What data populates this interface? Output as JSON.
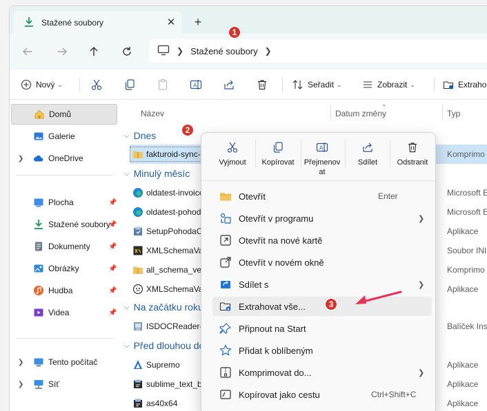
{
  "tab": {
    "title": "Stažené soubory",
    "close_icon": "close-icon",
    "new_tab_icon": "plus-icon"
  },
  "address": {
    "crumbs": [
      "Stažené soubory"
    ]
  },
  "toolbar": {
    "new_label": "Nový",
    "sort_label": "Seřadit",
    "view_label": "Zobrazit",
    "extract_label": "Extraho"
  },
  "sidebar": {
    "items": [
      {
        "label": "Domů"
      },
      {
        "label": "Galerie"
      },
      {
        "label": "OneDrive"
      },
      {
        "label": "Plocha"
      },
      {
        "label": "Stažené soubory"
      },
      {
        "label": "Dokumenty"
      },
      {
        "label": "Obrázky"
      },
      {
        "label": "Hudba"
      },
      {
        "label": "Videa"
      },
      {
        "label": "Tento počítač"
      },
      {
        "label": "Síť"
      }
    ]
  },
  "columns": {
    "name": "Název",
    "date": "Datum změny",
    "type": "Typ"
  },
  "groups": {
    "today": "Dnes",
    "last_month": "Minulý měsíc",
    "year_start": "Na začátku roku",
    "long_ago": "Před dlouhou do"
  },
  "files": [
    {
      "name": "fakturoid-sync-v1",
      "type": "Komprimo"
    },
    {
      "name": "oldatest-invoices_",
      "type": "Microsoft E"
    },
    {
      "name": "oldatest-pohoda-",
      "type": "Microsoft E"
    },
    {
      "name": "SetupPohodaCZ_",
      "type": "Aplikace"
    },
    {
      "name": "XMLSchemaValid",
      "type": "Soubor INI"
    },
    {
      "name": "all_schema_ver2",
      "type": "Komprimo"
    },
    {
      "name": "XMLSchemaValid",
      "type": "Aplikace"
    },
    {
      "name": "ISDOCReader-4.0.",
      "type": "Balíček Inst"
    },
    {
      "name": "Supremo",
      "type": "Aplikace"
    },
    {
      "name": "sublime_text_buil",
      "type": "Aplikace"
    },
    {
      "name": "as40x64",
      "type": "Aplikace"
    }
  ],
  "context_menu": {
    "actions": [
      {
        "label": "Vyjmout"
      },
      {
        "label": "Kopírovat"
      },
      {
        "label": "Přejmenov at"
      },
      {
        "label": "Sdílet"
      },
      {
        "label": "Odstranit"
      }
    ],
    "items": [
      {
        "label": "Otevřít",
        "shortcut": "Enter"
      },
      {
        "label": "Otevřít v programu"
      },
      {
        "label": "Otevřít na nové kartě"
      },
      {
        "label": "Otevřít v novém okně"
      },
      {
        "label": "Sdílet s"
      },
      {
        "label": "Extrahovat vše..."
      },
      {
        "label": "Připnout na Start"
      },
      {
        "label": "Přidat k oblíbeným"
      },
      {
        "label": "Komprimovat do..."
      },
      {
        "label": "Kopírovat jako cestu",
        "shortcut": "Ctrl+Shift+C"
      }
    ]
  },
  "annotations": {
    "badge1": "1",
    "badge2": "2",
    "badge3": "3"
  },
  "colors": {
    "accent": "#0067c0",
    "group_heading": "#1f5ea8",
    "selection": "#cce4f7",
    "badge": "#d9322b",
    "arrow": "#e8315a"
  }
}
